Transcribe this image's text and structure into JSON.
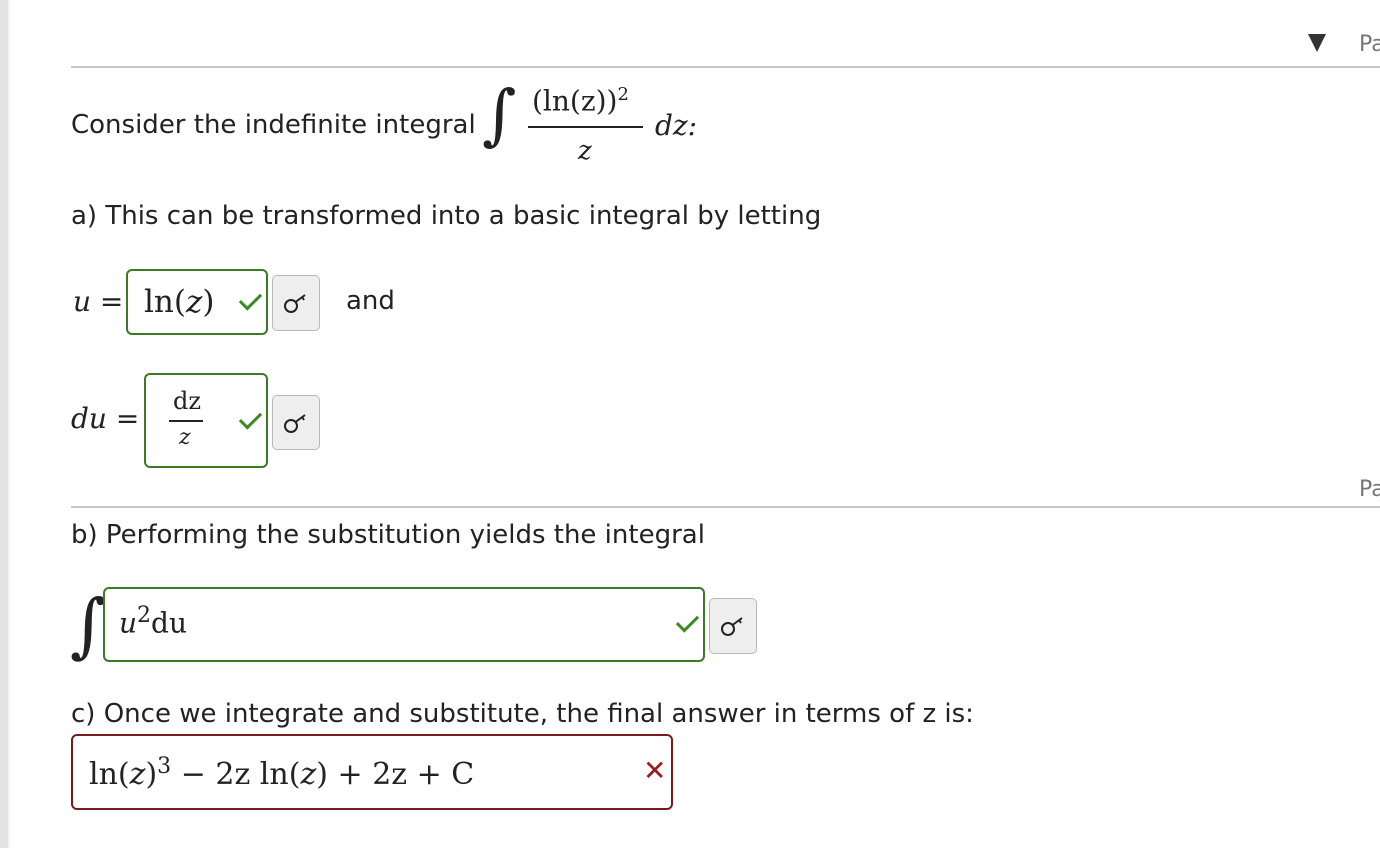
{
  "header": {
    "part_label_top": "Pa",
    "part_label_mid": "Pa"
  },
  "question": {
    "intro": "Consider the indefinite integral",
    "integrand_numerator": "(ln(z))",
    "integrand_exponent": "2",
    "integrand_denominator": "z",
    "differential": "dz:"
  },
  "part_a": {
    "prompt": "a) This can be transformed into a basic integral by letting",
    "u_label": "u =",
    "u_answer": {
      "fn": "ln",
      "open": "(",
      "var": "z",
      "close": ")",
      "status": "correct"
    },
    "and_text": "and",
    "du_label": "du =",
    "du_answer": {
      "numerator": "dz",
      "denominator": "z",
      "status": "correct"
    }
  },
  "part_b": {
    "prompt": "b) Performing the substitution yields the integral",
    "answer": {
      "base": "u",
      "exponent": "2",
      "tail": "du",
      "status": "correct"
    }
  },
  "part_c": {
    "prompt": "c) Once we integrate and substitute, the final answer in terms of z is:",
    "answer": {
      "t1": "ln",
      "t2": "(",
      "t3": "z",
      "t4": ")",
      "t5": "3",
      "t6": " − 2z ln",
      "t7": "(",
      "t8": "z",
      "t9": ")",
      "t10": " + 2z + C",
      "status": "incorrect"
    }
  },
  "icons": {
    "correct": "check-icon",
    "incorrect": "cross-icon",
    "key": "key-icon"
  },
  "colors": {
    "correct": "#3c7a24",
    "incorrect": "#7a1a1a"
  }
}
